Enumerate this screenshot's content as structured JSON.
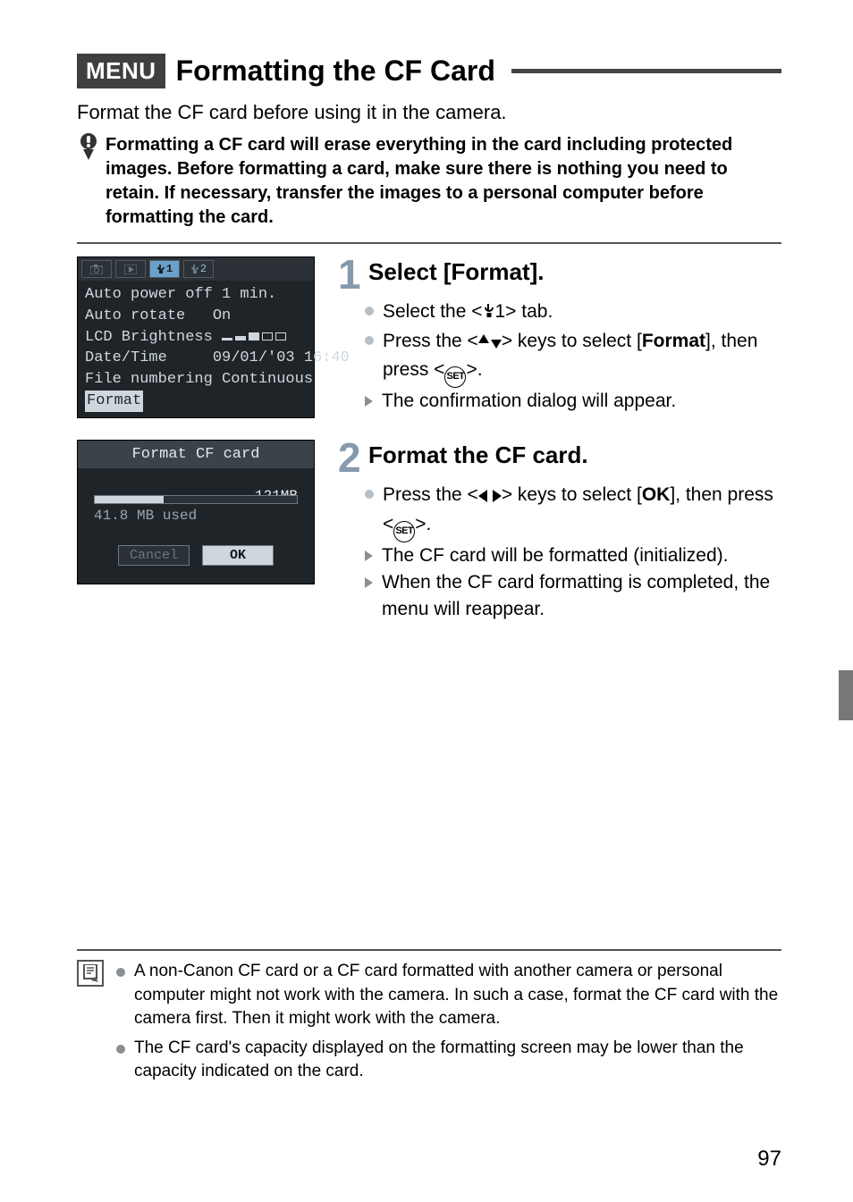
{
  "header": {
    "menu_badge": "MENU",
    "title": "Formatting the CF Card"
  },
  "intro": "Format the CF card before using it in the camera.",
  "warning": "Formatting a CF card will erase everything in the card including protected images. Before formatting a card, make sure there is nothing you need to retain. If necessary, transfer the images to a personal computer before formatting the card.",
  "lcd1": {
    "tab3": "1",
    "tab4": "2",
    "auto_power_off": "Auto power off 1 min.",
    "auto_rotate": "Auto rotate   On",
    "brightness_label": "LCD Brightness",
    "date_time": "Date/Time     09/01/'03 16:40",
    "file_numbering": "File numbering Continuous",
    "format": "Format"
  },
  "lcd2": {
    "title": "Format CF card",
    "total": "121MB",
    "used": "41.8 MB used",
    "cancel": "Cancel",
    "ok": "OK"
  },
  "step1": {
    "num": "1",
    "title": "Select [Format].",
    "b1_pre": "Select the <",
    "b1_post": "1> tab.",
    "b2_pre": "Press the <",
    "b2_mid": "> keys to select [",
    "b2_bold": "Format",
    "b2_mid2": "], then press <",
    "b2_post": ">.",
    "b3": "The confirmation dialog will appear."
  },
  "step2": {
    "num": "2",
    "title": "Format the CF card.",
    "b1_pre": "Press the <",
    "b1_mid": "> keys to select [",
    "b1_bold": "OK",
    "b1_mid2": "], then press <",
    "b1_post": ">.",
    "b2": "The CF card will be formatted (initialized).",
    "b3": "When the CF card formatting is completed, the menu will reappear."
  },
  "notes": {
    "n1": "A non-Canon CF card or a CF card formatted with another camera or personal computer might not work with the camera. In such a case, format the CF card with the camera first. Then it might work with the camera.",
    "n2": "The CF card's capacity displayed on the formatting screen may be lower than the capacity indicated on the card."
  },
  "page_number": "97"
}
